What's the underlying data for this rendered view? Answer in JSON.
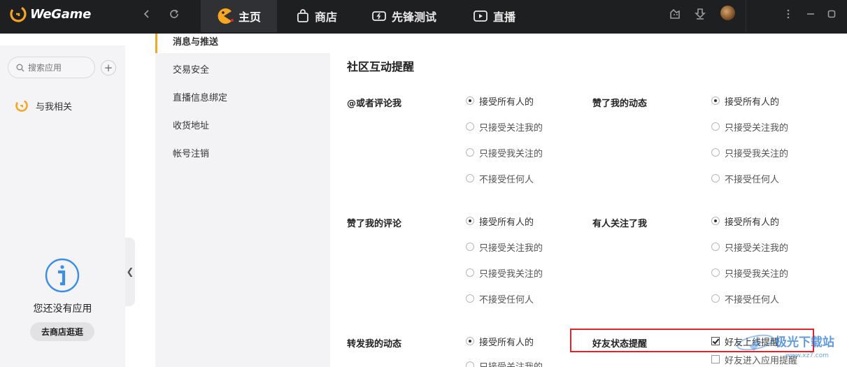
{
  "topbar": {
    "app_name": "WeGame",
    "tabs": [
      {
        "label": "主页",
        "active": true
      },
      {
        "label": "商店",
        "active": false
      },
      {
        "label": "先锋测试",
        "active": false
      },
      {
        "label": "直播",
        "active": false
      }
    ],
    "icons": [
      "back-icon",
      "refresh-icon",
      "skin-icon",
      "download-icon",
      "avatar",
      "more-icon",
      "minimize-icon",
      "maximize-icon"
    ]
  },
  "left_panel": {
    "search_placeholder": "搜索应用",
    "related_label": "与我相关",
    "empty_text": "您还没有应用",
    "store_button": "去商店逛逛",
    "collapse_glyph": "❮"
  },
  "settings_menu": {
    "items": [
      "消息与推送",
      "交易安全",
      "直播信息绑定",
      "收货地址",
      "帐号注销"
    ],
    "active_index": 0
  },
  "content": {
    "section_title": "社区互动提醒",
    "groups": [
      {
        "label": "@或者评论我",
        "options": [
          "接受所有人的",
          "只接受关注我的",
          "只接受我关注的",
          "不接受任何人"
        ],
        "selected": 0
      },
      {
        "label": "赞了我的动态",
        "options": [
          "接受所有人的",
          "只接受关注我的",
          "只接受我关注的",
          "不接受任何人"
        ],
        "selected": 0
      },
      {
        "label": "赞了我的评论",
        "options": [
          "接受所有人的",
          "只接受关注我的",
          "只接受我关注的",
          "不接受任何人"
        ],
        "selected": 0
      },
      {
        "label": "有人关注了我",
        "options": [
          "接受所有人的",
          "只接受关注我的",
          "只接受我关注的",
          "不接受任何人"
        ],
        "selected": 0
      },
      {
        "label": "转发我的动态",
        "options": [
          "接受所有人的",
          "只接受关注我的"
        ],
        "selected": 0
      }
    ],
    "friend_status": {
      "label": "好友状态提醒",
      "options": [
        {
          "label": "好友上线提醒",
          "checked": true
        },
        {
          "label": "好友进入应用提醒",
          "checked": false
        }
      ]
    }
  },
  "watermark": {
    "text": "极光下载站",
    "sub": "www.xz7.com"
  },
  "colors": {
    "topbar": "#1e1f21",
    "accent": "#f6a623",
    "highlight_box": "#e0242a",
    "info_icon": "#3a8ee6"
  }
}
